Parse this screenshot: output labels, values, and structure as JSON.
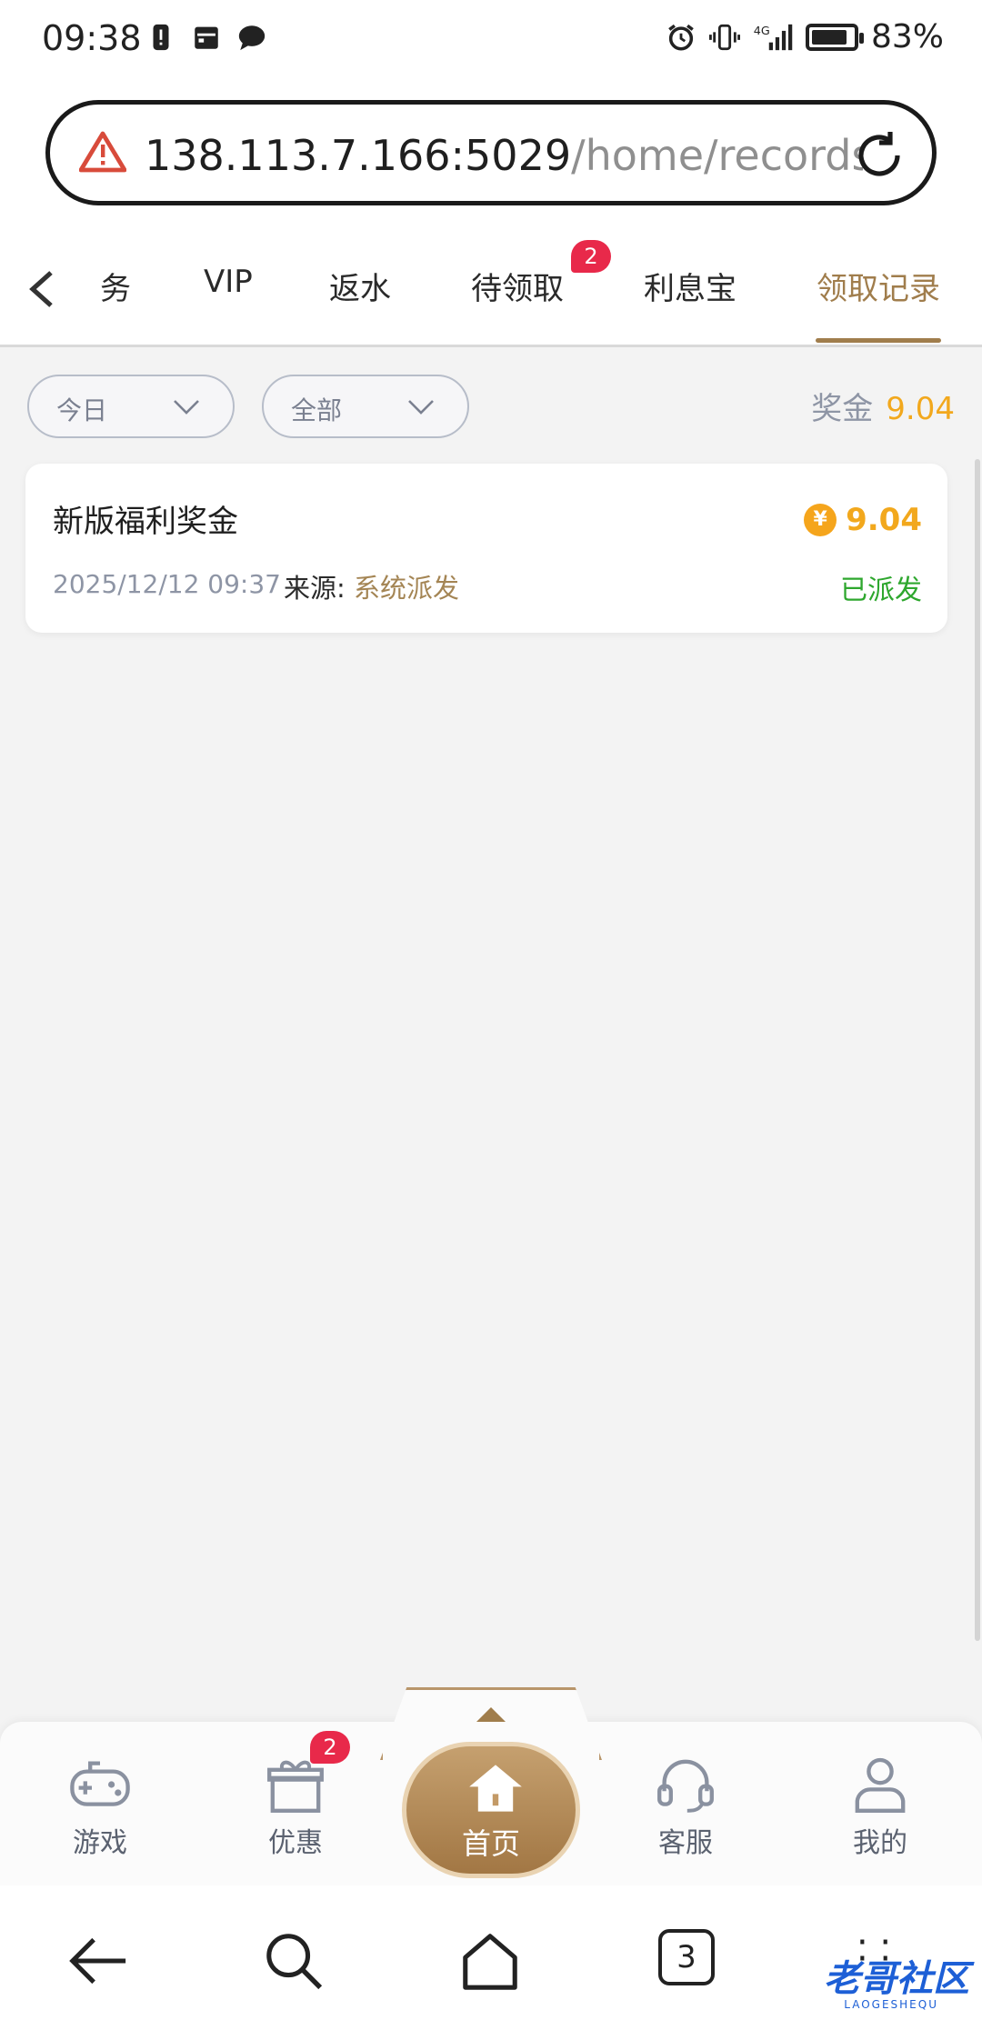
{
  "status_bar": {
    "time": "09:38",
    "battery": "83%",
    "battery_level": 0.83,
    "network": "4G"
  },
  "url_bar": {
    "host": "138.113.7.166:5029",
    "path": "/home/records",
    "warning_icon": "warning-triangle-icon",
    "reload_icon": "reload-icon"
  },
  "tabs": {
    "items": [
      {
        "label": "务"
      },
      {
        "label": "VIP"
      },
      {
        "label": "返水"
      },
      {
        "label": "待领取",
        "badge": "2"
      },
      {
        "label": "利息宝"
      },
      {
        "label": "领取记录",
        "active": true
      }
    ]
  },
  "filters": {
    "date": "今日",
    "type": "全部"
  },
  "summary": {
    "label": "奖金",
    "value": "9.04"
  },
  "records": [
    {
      "title": "新版福利奖金",
      "amount": "9.04",
      "coin_symbol": "¥",
      "date": "2025/12/12 09:37",
      "source_label": "来源:",
      "source_value": "系统派发",
      "status": "已派发"
    }
  ],
  "bottom_nav": {
    "items": [
      {
        "label": "游戏",
        "icon": "gamepad-icon"
      },
      {
        "label": "优惠",
        "icon": "gift-icon",
        "badge": "2"
      },
      {
        "label": "首页",
        "icon": "home-icon"
      },
      {
        "label": "客服",
        "icon": "headset-icon"
      },
      {
        "label": "我的",
        "icon": "user-icon"
      }
    ]
  },
  "system_nav": {
    "tab_count": "3",
    "watermark": "老哥社区",
    "watermark_sub": "LAOGESHEQU"
  },
  "colors": {
    "accent": "#a07d4c",
    "amount": "#f2a81d",
    "success": "#2ea72e",
    "badge": "#e8294a"
  }
}
